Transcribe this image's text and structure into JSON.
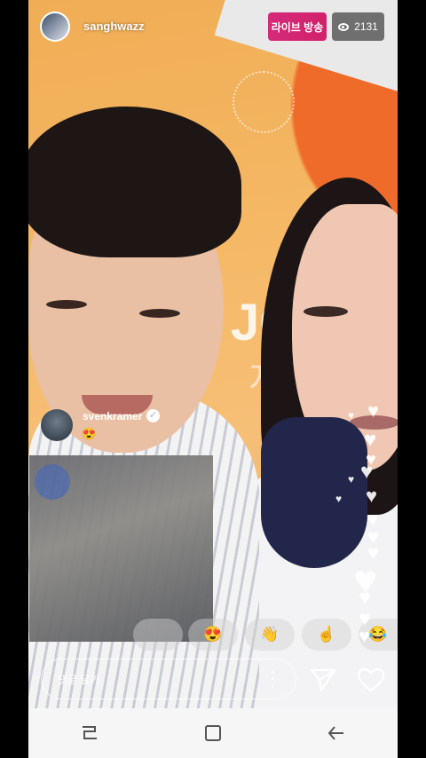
{
  "header": {
    "username": "sanghwazz",
    "live_label": "라이브 방송",
    "viewer_count": "2131"
  },
  "comments": [
    {
      "username": "svenkramer",
      "verified": true,
      "text": "😍"
    }
  ],
  "reactions": [
    "😍",
    "👋",
    "☝",
    "😂"
  ],
  "input": {
    "placeholder": "댓글 달기"
  },
  "icons": {
    "more": "more-vertical-icon",
    "send": "paper-plane-icon",
    "like": "heart-outline-icon",
    "nav_recent": "recent-apps-icon",
    "nav_home": "home-icon",
    "nav_back": "back-icon"
  },
  "colors": {
    "live_badge": "#d42a7a",
    "comment_emoji": "#ffcf3a"
  }
}
